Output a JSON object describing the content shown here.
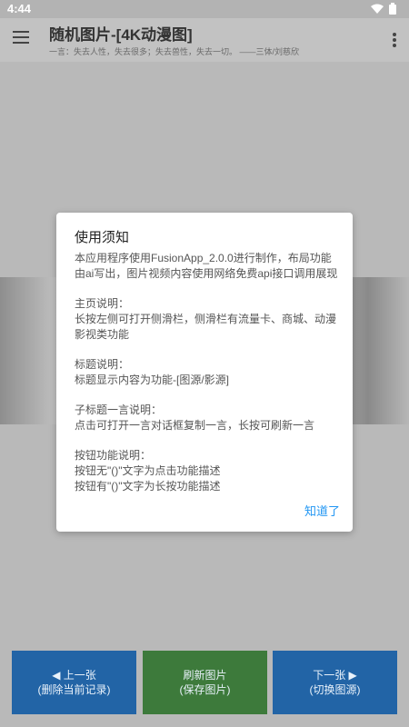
{
  "status_bar": {
    "time": "4:44"
  },
  "app_bar": {
    "title": "随机图片-[4K动漫图]",
    "subtitle": "一言：失去人性，失去很多；失去兽性，失去一切。 ——三体/刘慈欣"
  },
  "dialog": {
    "title": "使用须知",
    "paragraphs": [
      "本应用程序使用FusionApp_2.0.0进行制作，布局功能由ai写出，图片视频内容使用网络免费api接口调用展现",
      "主页说明：\n长按左侧可打开侧滑栏，侧滑栏有流量卡、商城、动漫影视类功能",
      "标题说明：\n标题显示内容为功能-[图源/影源]",
      "子标题一言说明：\n点击可打开一言对话框复制一言，长按可刷新一言",
      "按钮功能说明：\n按钮无\"()\"文字为点击功能描述\n按钮有\"()\"文字为长按功能描述"
    ],
    "ok_label": "知道了"
  },
  "buttons": {
    "prev_line1": "◀ 上一张",
    "prev_line2": "(删除当前记录)",
    "refresh_line1": "刷新图片",
    "refresh_line2": "(保存图片)",
    "next_line1": "下一张 ▶",
    "next_line2": "(切换图源)"
  },
  "colors": {
    "accent": "#2196f3",
    "button_blue": "#2264a6",
    "button_green": "#3d7a3b"
  }
}
